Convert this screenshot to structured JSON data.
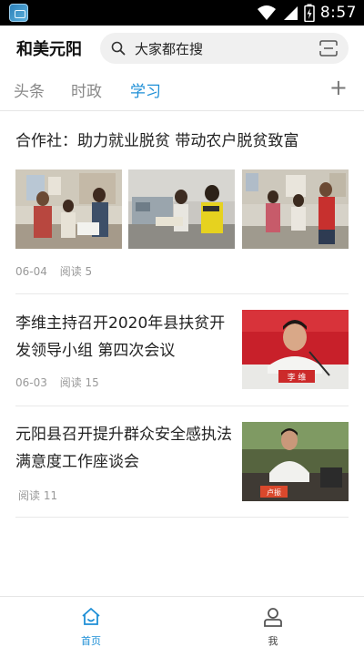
{
  "status_bar": {
    "time": "8:57",
    "icons": [
      "app-icon",
      "wifi-icon",
      "signal-icon",
      "battery-icon"
    ]
  },
  "header": {
    "title": "和美元阳",
    "search_placeholder": "大家都在搜"
  },
  "tabs": [
    {
      "label": "头条",
      "active": false
    },
    {
      "label": "时政",
      "active": false
    },
    {
      "label": "学习",
      "active": true
    }
  ],
  "articles": [
    {
      "title": "合作社：助力就业脱贫 带动农户脱贫致富",
      "date": "06-04",
      "reads": "阅读 5"
    },
    {
      "title": "李维主持召开2020年县扶贫开发领导小组 第四次会议",
      "date": "06-03",
      "reads": "阅读 15",
      "thumb_nameplate": "李 维"
    },
    {
      "title": "元阳县召开提升群众安全感执法满意度工作座谈会",
      "reads": "阅读 11",
      "thumb_nameplate": "卢振"
    }
  ],
  "bottom_nav": [
    {
      "label": "首页",
      "icon": "home-icon",
      "active": true
    },
    {
      "label": "我",
      "icon": "user-icon",
      "active": false
    }
  ],
  "colors": {
    "accent": "#1e8fd6",
    "text": "#222222",
    "meta": "#999999",
    "status_bar": "#000000"
  }
}
